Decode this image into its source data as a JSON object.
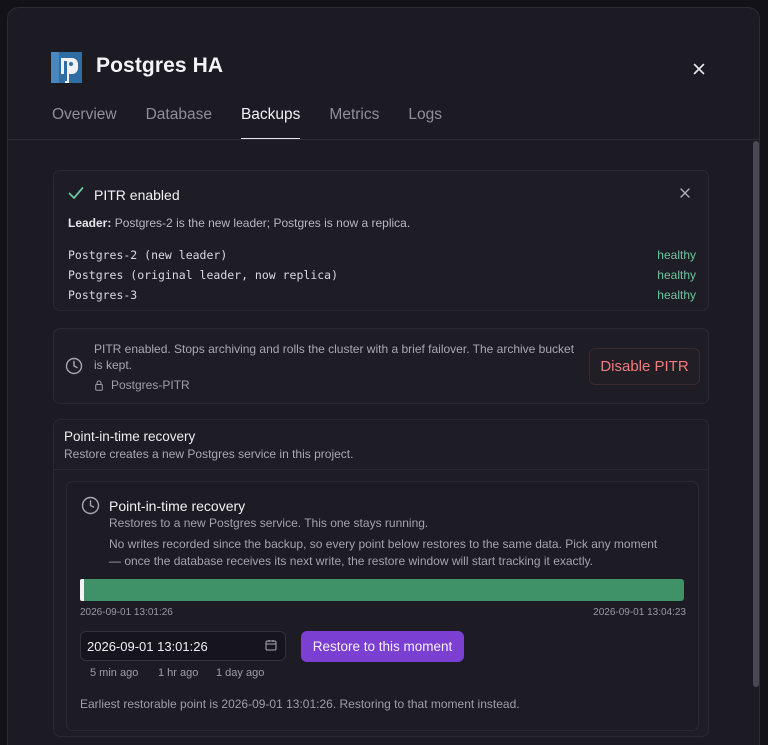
{
  "header": {
    "title": "Postgres HA",
    "tabs": [
      {
        "label": "Overview"
      },
      {
        "label": "Database"
      },
      {
        "label": "Backups",
        "active": true
      },
      {
        "label": "Metrics"
      },
      {
        "label": "Logs"
      }
    ]
  },
  "pitr_status": {
    "title": "PITR enabled",
    "leader_label": "Leader:",
    "leader_text": "Postgres-2 is the new leader; Postgres is now a replica.",
    "nodes": [
      {
        "name": "Postgres-2 (new leader)",
        "status": "healthy"
      },
      {
        "name": "Postgres (original leader, now replica)",
        "status": "healthy"
      },
      {
        "name": "Postgres-3",
        "status": "healthy"
      }
    ]
  },
  "disable": {
    "description": "PITR enabled. Stops archiving and rolls the cluster with a brief failover. The archive bucket is kept.",
    "bucket": "Postgres-PITR",
    "button_label": "Disable PITR"
  },
  "recovery": {
    "section_title": "Point-in-time recovery",
    "section_subtitle": "Restore creates a new Postgres service in this project.",
    "card_title": "Point-in-time recovery",
    "card_subtitle": "Restores to a new Postgres service. This one stays running.",
    "note": "No writes recorded since the backup, so every point below restores to the same data. Pick any moment — once the database receives its next write, the restore window will start tracking it exactly.",
    "timeline_start": "2026-09-01 13:01:26",
    "timeline_end": "2026-09-01 13:04:23",
    "selected_fraction": 0.0,
    "date_value": "2026-09-01 13:01:26",
    "restore_label": "Restore to this moment",
    "quick_picks": [
      "5 min ago",
      "1 hr ago",
      "1 day ago"
    ],
    "earliest_note": "Earliest restorable point is 2026-09-01 13:01:26. Restoring to that moment instead."
  },
  "colors": {
    "accent": "#7b3fd1",
    "healthy": "#6cc59b",
    "timeline": "#3f9267",
    "danger": "#f07c7c"
  },
  "icons": {
    "logo": "postgres-elephant-icon",
    "close": "close-icon",
    "check": "check-icon",
    "clock": "clock-icon",
    "lock": "lock-icon",
    "calendar": "calendar-icon"
  }
}
